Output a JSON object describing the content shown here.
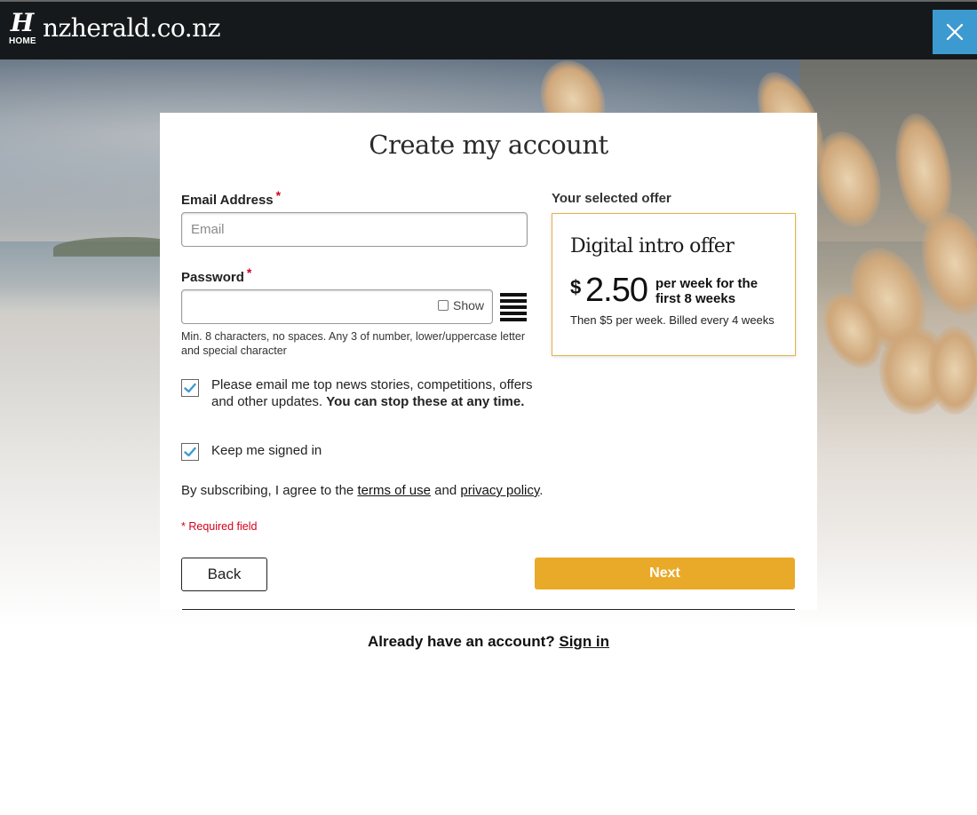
{
  "header": {
    "logo_letter": "H",
    "logo_home": "HOME",
    "site_name": "nzherald.co.nz",
    "close_icon": "close-icon"
  },
  "form": {
    "title": "Create my account",
    "email": {
      "label": "Email Address",
      "required_mark": "*",
      "placeholder": "Email",
      "value": ""
    },
    "password": {
      "label": "Password",
      "required_mark": "*",
      "value": "",
      "show_label": "Show",
      "hint": "Min. 8 characters, no spaces. Any 3 of number, lower/uppercase letter and special character"
    },
    "newsletter": {
      "checked": true,
      "text": "Please email me top news stories, competitions, offers and other updates.",
      "bold_text": "You can stop these at any time."
    },
    "keep_signed_in": {
      "checked": true,
      "text": "Keep me signed in"
    },
    "agree": {
      "prefix": "By subscribing, I agree to the",
      "terms_link": "terms of use",
      "and": "and",
      "privacy_link": "privacy policy",
      "suffix": "."
    },
    "required_note": "* Required field",
    "back_label": "Back",
    "next_label": "Next",
    "signin_prompt": "Already have an account?",
    "signin_link": "Sign in"
  },
  "offer": {
    "heading": "Your selected offer",
    "name": "Digital intro offer",
    "currency": "$",
    "price": "2.50",
    "per": "per week for the first 8 weeks",
    "note": "Then $5 per week. Billed every 4 weeks"
  },
  "colors": {
    "accent": "#e9aa29",
    "close_bg": "#3d9ad1",
    "checkmark": "#3d9ad1",
    "required": "#d0021b",
    "topbar": "#16191b"
  }
}
